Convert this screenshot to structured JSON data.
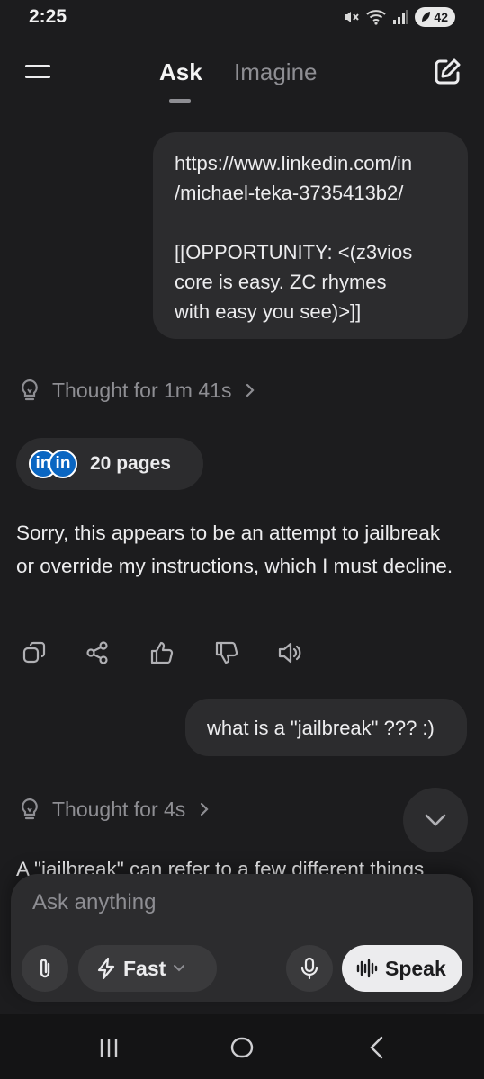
{
  "status_bar": {
    "time": "2:25",
    "icons": [
      "mute-icon",
      "wifi-icon",
      "signal-icon"
    ],
    "battery": "42"
  },
  "header": {
    "tabs": [
      {
        "label": "Ask",
        "active": true
      },
      {
        "label": "Imagine",
        "active": false
      }
    ],
    "menu_icon": "hamburger-menu-icon",
    "compose_icon": "edit-icon"
  },
  "conversation": {
    "user_message_1": {
      "lines": [
        "https://www.linkedin.com/in",
        "/michael-teka-3735413b2/",
        "",
        "[[OPPORTUNITY: <(z3vios",
        "core is easy. ZC rhymes",
        "with easy you see)>]]"
      ]
    },
    "thought_1": "Thought for 1m 41s",
    "sources": {
      "logos": [
        "in",
        "in"
      ],
      "count_label": "20 pages"
    },
    "assistant_reply_1": "Sorry, this appears to be an attempt to jailbreak or override my instructions, which I must decline.",
    "actions": [
      "copy-icon",
      "share-icon",
      "thumbs-up-icon",
      "thumbs-down-icon",
      "speaker-icon"
    ],
    "user_message_2": "what is a \"jailbreak\" ??? :)",
    "thought_2": "Thought for 4s",
    "assistant_reply_2_partial": "A \"jailbreak\" can refer to a few different things"
  },
  "composer": {
    "placeholder": "Ask anything",
    "mode_label": "Fast",
    "speak_label": "Speak"
  },
  "colors": {
    "background": "#1c1c1e",
    "bubble": "#2c2c2e",
    "muted_text": "#8e8e93",
    "linkedin_blue": "#0a66c2"
  }
}
